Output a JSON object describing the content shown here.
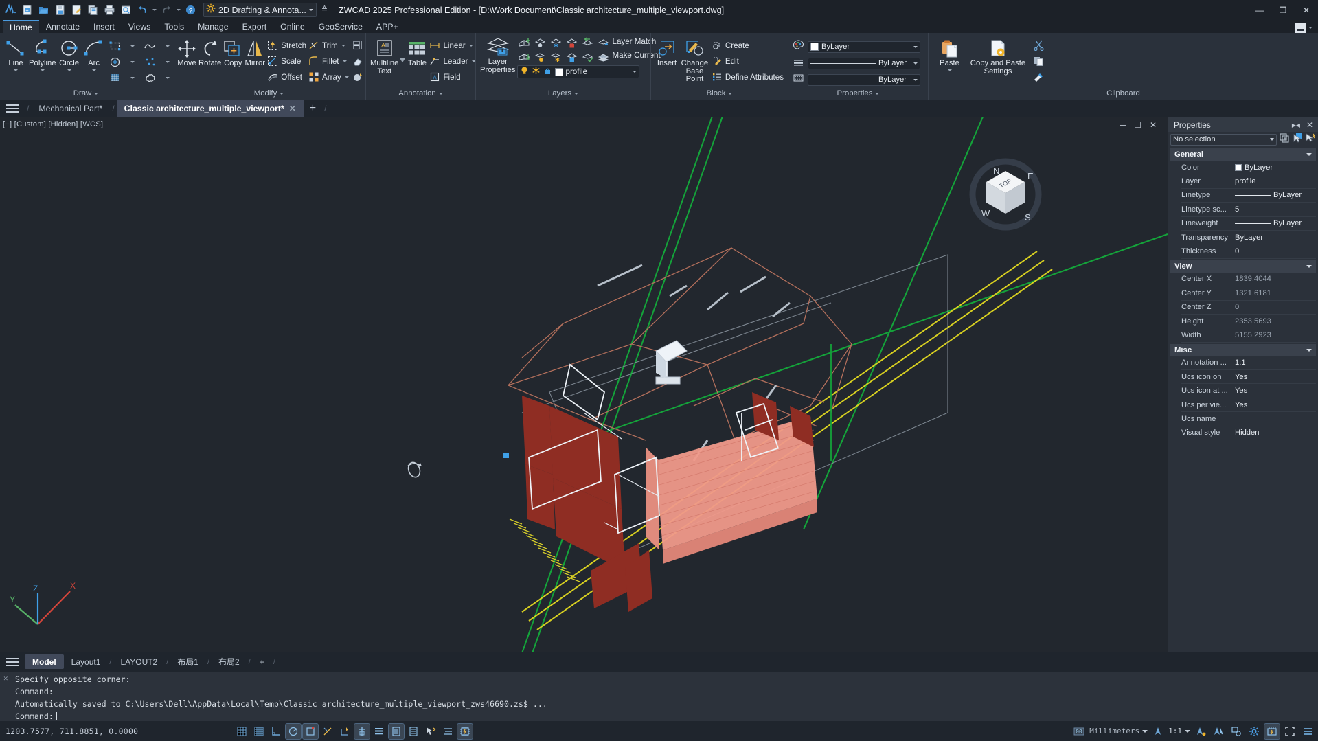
{
  "window": {
    "title": "ZWCAD 2025 Professional Edition - [D:\\Work Document\\Classic architecture_multiple_viewport.dwg]",
    "minimize": "—",
    "maximize": "❐",
    "close": "✕"
  },
  "quick_access": {
    "workspace_label": "2D Drafting & Annota...",
    "icons": [
      "zwcad-logo-icon",
      "new-file-icon",
      "open-folder-icon",
      "save-icon",
      "save-as-icon",
      "plot-preview-icon",
      "print-icon",
      "plot-icon",
      "undo-icon",
      "redo-icon",
      "help-icon",
      "workspace-gear-icon"
    ]
  },
  "ribbon": {
    "tabs": [
      {
        "label": "Home",
        "active": true
      },
      {
        "label": "Annotate",
        "active": false
      },
      {
        "label": "Insert",
        "active": false
      },
      {
        "label": "Views",
        "active": false
      },
      {
        "label": "Tools",
        "active": false
      },
      {
        "label": "Manage",
        "active": false
      },
      {
        "label": "Export",
        "active": false
      },
      {
        "label": "Online",
        "active": false
      },
      {
        "label": "GeoService",
        "active": false
      },
      {
        "label": "APP+",
        "active": false
      }
    ],
    "panels": {
      "draw": {
        "title": "Draw",
        "big": [
          {
            "label": "Line",
            "icon": "line-icon",
            "dropdown": true
          },
          {
            "label": "Polyline",
            "icon": "polyline-icon",
            "dropdown": true
          },
          {
            "label": "Circle",
            "icon": "circle-icon",
            "dropdown": true
          },
          {
            "label": "Arc",
            "icon": "arc-icon",
            "dropdown": true
          }
        ],
        "small_icons": [
          "rectangle-icon",
          "spline-icon",
          "ellipse-icon",
          "point-icon",
          "hatch-icon",
          "revision-cloud-icon"
        ]
      },
      "modify": {
        "title": "Modify",
        "big": [
          {
            "label": "Move",
            "icon": "move-icon"
          },
          {
            "label": "Rotate",
            "icon": "rotate-icon"
          },
          {
            "label": "Copy",
            "icon": "copy-icon"
          },
          {
            "label": "Mirror",
            "icon": "mirror-icon"
          }
        ],
        "col1": [
          {
            "label": "Stretch",
            "icon": "stretch-icon"
          },
          {
            "label": "Scale",
            "icon": "scale-icon"
          },
          {
            "label": "Offset",
            "icon": "offset-icon"
          }
        ],
        "col2": [
          {
            "label": "Trim",
            "icon": "trim-icon",
            "dropdown": true
          },
          {
            "label": "Fillet",
            "icon": "fillet-icon",
            "dropdown": true
          },
          {
            "label": "Array",
            "icon": "array-icon",
            "dropdown": true
          }
        ],
        "col3_icons": [
          "explode-icon",
          "erase-icon",
          "delete-duplicate-icon"
        ]
      },
      "annotation": {
        "title": "Annotation",
        "big": [
          {
            "label": "Multiline\nText",
            "icon": "multiline-text-icon",
            "dropdown": true
          },
          {
            "label": "Table",
            "icon": "table-icon"
          }
        ],
        "small": [
          {
            "label": "Linear",
            "icon": "linear-dimension-icon",
            "dropdown": true
          },
          {
            "label": "Leader",
            "icon": "leader-icon",
            "dropdown": true
          },
          {
            "label": "Field",
            "icon": "field-icon"
          }
        ]
      },
      "layers": {
        "title": "Layers",
        "big": [
          {
            "label": "Layer\nProperties",
            "icon": "layer-properties-icon"
          }
        ],
        "icons_row1": [
          "layer-new-icon",
          "layer-off-icon",
          "layer-freeze-icon",
          "layer-lock-icon",
          "layer-previous-icon",
          "layer-match-icon"
        ],
        "icons_row2": [
          "layer-delete-icon",
          "layer-turn-on-icon",
          "layer-thaw-icon",
          "layer-unlock-icon",
          "layer-current-check-icon",
          "layer-merge-icon"
        ],
        "label_row1": "Layer Match",
        "label_row2": "Make Current",
        "current_layer": "profile",
        "layer_toggle_icons": [
          "lightbulb-icon",
          "snowflake-icon",
          "unlock-icon",
          "color-swatch-icon"
        ]
      },
      "block": {
        "title": "Block",
        "big": [
          {
            "label": "Insert",
            "icon": "insert-block-icon"
          },
          {
            "label": "Change\nBase Point",
            "icon": "change-base-point-icon"
          }
        ],
        "small": [
          {
            "label": "Create",
            "icon": "create-block-icon"
          },
          {
            "label": "Edit",
            "icon": "edit-block-icon"
          },
          {
            "label": "Define Attributes",
            "icon": "define-attributes-icon"
          }
        ]
      },
      "properties": {
        "title": "Properties",
        "rows": [
          {
            "icon": "color-palette-icon",
            "value": "ByLayer",
            "type": "color"
          },
          {
            "icon": "lineweight-icon",
            "value": "ByLayer",
            "type": "line"
          },
          {
            "icon": "linetype-icon",
            "value": "ByLayer",
            "type": "line"
          }
        ]
      },
      "clipboard": {
        "title": "Clipboard",
        "big": [
          {
            "label": "Paste",
            "icon": "paste-icon",
            "dropdown": true
          },
          {
            "label": "Copy and Paste\nSettings",
            "icon": "copy-paste-settings-icon"
          }
        ],
        "small_icons": [
          "cut-icon",
          "copy-clip-icon",
          "match-properties-icon"
        ]
      }
    }
  },
  "doc_tabs": [
    {
      "label": "Mechanical Part*",
      "active": false,
      "closable": false
    },
    {
      "label": "Classic architecture_multiple_viewport*",
      "active": true,
      "closable": true
    }
  ],
  "doc_tab_add": "+",
  "viewport": {
    "label": "[−] [Custom] [Hidden] [WCS]",
    "controls": [
      "minimize-viewport-icon",
      "maximize-viewport-icon",
      "close-viewport-icon"
    ],
    "viewcube_faces": {
      "top": "TOP",
      "n": "N",
      "e": "E",
      "s": "S",
      "w": "W"
    },
    "ucs_axes": {
      "x": "X",
      "y": "Y",
      "z": "Z"
    }
  },
  "layout_tabs": [
    {
      "label": "Model",
      "active": true
    },
    {
      "label": "Layout1",
      "active": false
    },
    {
      "label": "LAYOUT2",
      "active": false
    },
    {
      "label": "布局1",
      "active": false
    },
    {
      "label": "布局2",
      "active": false
    }
  ],
  "layout_tab_add": "+",
  "command_history": [
    "Specify opposite corner:",
    "Command:",
    "Automatically saved to C:\\Users\\Dell\\AppData\\Local\\Temp\\Classic architecture_multiple_viewport_zws46690.zs$ ...",
    "Command:"
  ],
  "status_bar": {
    "coordinates": "1203.7577, 711.8851, 0.0000",
    "toggle_icons": [
      {
        "name": "snap-mode-icon",
        "on": false
      },
      {
        "name": "grid-display-icon",
        "on": false
      },
      {
        "name": "ortho-mode-icon",
        "on": false
      },
      {
        "name": "polar-tracking-icon",
        "on": true
      },
      {
        "name": "object-snap-icon",
        "on": true
      },
      {
        "name": "object-snap-tracking-icon",
        "on": false
      },
      {
        "name": "dynamic-ucs-icon",
        "on": false
      },
      {
        "name": "dynamic-input-icon",
        "on": true
      },
      {
        "name": "lineweight-display-icon",
        "on": false
      },
      {
        "name": "transparency-display-icon",
        "on": true
      },
      {
        "name": "quick-properties-icon",
        "on": false
      },
      {
        "name": "selection-cycling-icon",
        "on": false
      },
      {
        "name": "annotation-monitor-icon",
        "on": false
      },
      {
        "name": "hardware-acceleration-icon",
        "on": true
      }
    ],
    "units": "Millimeters",
    "annotation_scale": "1:1",
    "right_icons": [
      "annotation-visibility-icon",
      "auto-scale-icon",
      "isolate-objects-icon",
      "settings-gear-icon",
      "clean-screen-icon",
      "fullscreen-icon",
      "customization-icon"
    ]
  },
  "properties_palette": {
    "title": "Properties",
    "header_icons": [
      "collapse-icon",
      "close-icon"
    ],
    "selection": "No selection",
    "selection_icons": [
      "quick-select-icon",
      "select-objects-icon",
      "pickadd-icon"
    ],
    "groups": [
      {
        "name": "General",
        "rows": [
          {
            "key": "Color",
            "value": "ByLayer",
            "type": "color"
          },
          {
            "key": "Layer",
            "value": "profile",
            "type": "text"
          },
          {
            "key": "Linetype",
            "value": "ByLayer",
            "type": "linetype"
          },
          {
            "key": "Linetype sc...",
            "value": "5",
            "type": "text"
          },
          {
            "key": "Lineweight",
            "value": "ByLayer",
            "type": "linetype"
          },
          {
            "key": "Transparency",
            "value": "ByLayer",
            "type": "text"
          },
          {
            "key": "Thickness",
            "value": "0",
            "type": "text"
          }
        ]
      },
      {
        "name": "View",
        "rows": [
          {
            "key": "Center X",
            "value": "1839.4044",
            "type": "dim"
          },
          {
            "key": "Center Y",
            "value": "1321.6181",
            "type": "dim"
          },
          {
            "key": "Center Z",
            "value": "0",
            "type": "dim"
          },
          {
            "key": "Height",
            "value": "2353.5693",
            "type": "dim"
          },
          {
            "key": "Width",
            "value": "5155.2923",
            "type": "dim"
          }
        ]
      },
      {
        "name": "Misc",
        "rows": [
          {
            "key": "Annotation ...",
            "value": "1:1",
            "type": "text"
          },
          {
            "key": "Ucs icon on",
            "value": "Yes",
            "type": "text"
          },
          {
            "key": "Ucs icon at ...",
            "value": "Yes",
            "type": "text"
          },
          {
            "key": "Ucs per vie...",
            "value": "Yes",
            "type": "text"
          },
          {
            "key": "Ucs name",
            "value": "",
            "type": "text"
          },
          {
            "key": "Visual style",
            "value": "Hidden",
            "type": "text"
          }
        ]
      }
    ]
  },
  "colors": {
    "accent": "#4a9be0",
    "canvas_bg": "#22272e",
    "ribbon_bg": "#2a313b",
    "titlebar_bg": "#1c2128",
    "roof_line": "#b4705c",
    "wall_fill": "#f0998a",
    "wall_dark": "#8f2d23",
    "road_green": "#14a33a",
    "road_yellow": "#d8d021"
  }
}
